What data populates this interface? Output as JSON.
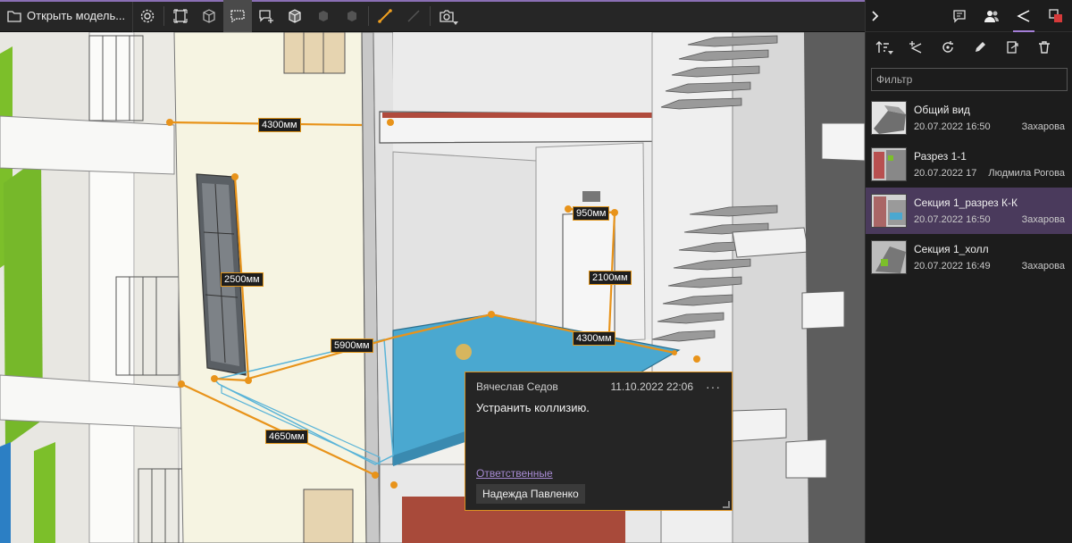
{
  "toolbar": {
    "open_model_label": "Открыть модель...",
    "tools": [
      {
        "icon": "settings-icon"
      },
      {
        "icon": "fit-view-icon"
      },
      {
        "icon": "cube-icon"
      },
      {
        "icon": "comment-area-icon",
        "active": true
      },
      {
        "icon": "add-comment-icon"
      },
      {
        "icon": "section-box-icon"
      },
      {
        "icon": "hide-element-icon",
        "disabled": true
      },
      {
        "icon": "isolate-element-icon",
        "disabled": true
      },
      {
        "icon": "measure-icon"
      },
      {
        "icon": "measure-point-icon",
        "disabled": true
      },
      {
        "icon": "screenshot-icon",
        "has_menu": true
      }
    ]
  },
  "dimensions": [
    {
      "label": "4300мм"
    },
    {
      "label": "2500мм"
    },
    {
      "label": "950мм"
    },
    {
      "label": "2100мм"
    },
    {
      "label": "5900мм"
    },
    {
      "label": "4300мм"
    },
    {
      "label": "4650мм"
    }
  ],
  "comment": {
    "author": "Вячеслав Седов",
    "date": "11.10.2022 22:06",
    "more": "···",
    "text": "Устранить коллизию.",
    "responsible_label": "Ответственные",
    "responsible_person": "Надежда Павленко"
  },
  "panel": {
    "filter_placeholder": "Фильтр",
    "views": [
      {
        "name": "Общий вид",
        "date": "20.07.2022 16:50",
        "author": "Захарова",
        "selected": false
      },
      {
        "name": "Разрез 1-1",
        "date": "20.07.2022 17",
        "author": "Людмила Рогова",
        "selected": false
      },
      {
        "name": "Секция 1_разрез К-К",
        "date": "20.07.2022 16:50",
        "author": "Захарова",
        "selected": true
      },
      {
        "name": "Секция 1_холл",
        "date": "20.07.2022 16:49",
        "author": "Захарова",
        "selected": false
      }
    ]
  },
  "colors": {
    "accent": "#a57fd8",
    "measure": "#e8931a",
    "floor": "#4aa8d0",
    "wall_green": "#7cbf2a",
    "selected_row": "#4a3a5c"
  }
}
